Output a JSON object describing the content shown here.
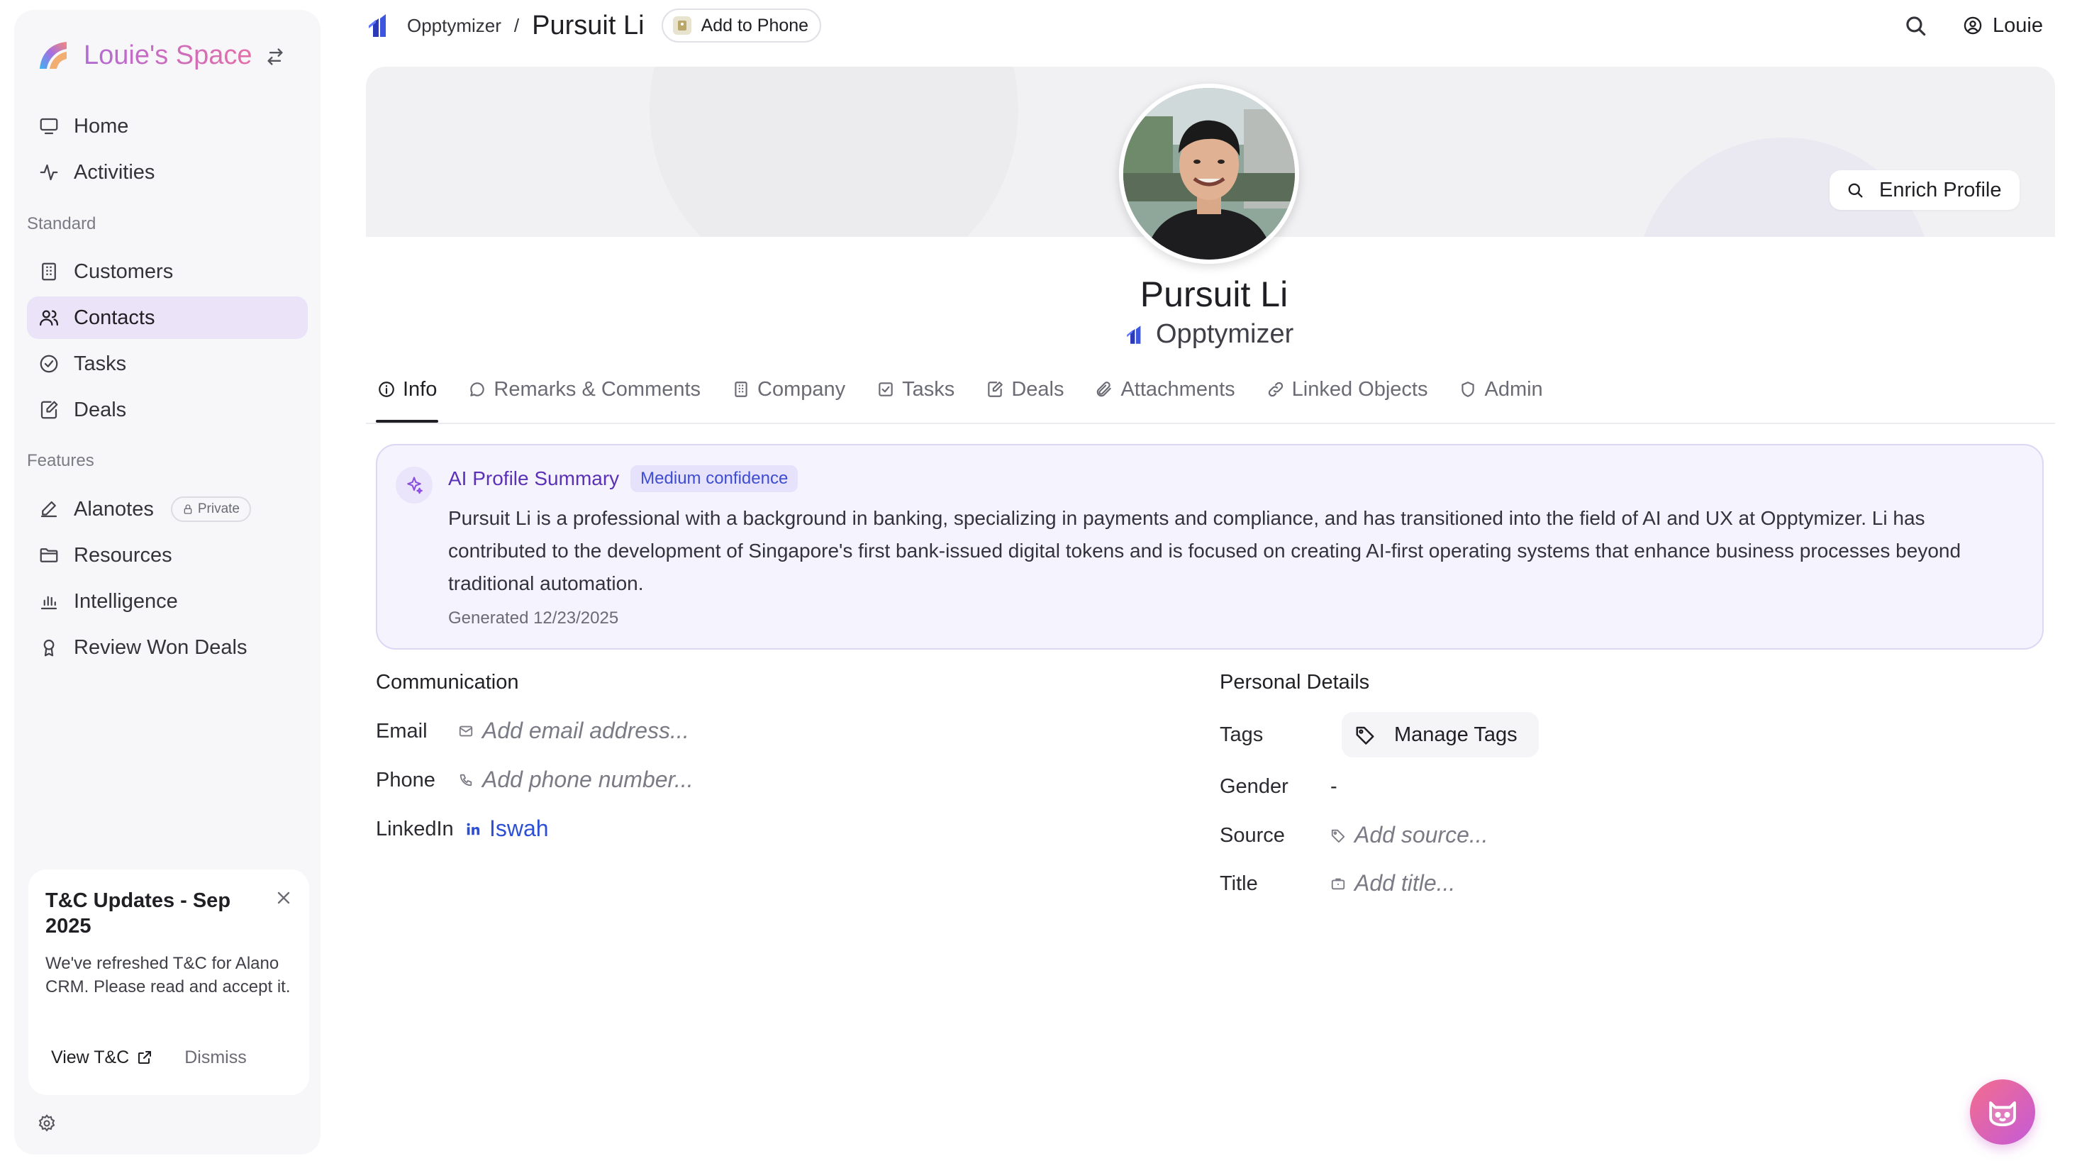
{
  "workspace": {
    "name": "Louie's Space"
  },
  "sidebar": {
    "items_main": [
      {
        "label": "Home",
        "icon": "monitor-icon"
      },
      {
        "label": "Activities",
        "icon": "activity-icon"
      }
    ],
    "standard_label": "Standard",
    "items_standard": [
      {
        "label": "Customers",
        "icon": "building-icon"
      },
      {
        "label": "Contacts",
        "icon": "users-icon",
        "active": true
      },
      {
        "label": "Tasks",
        "icon": "check-circle-icon"
      },
      {
        "label": "Deals",
        "icon": "edit-doc-icon"
      }
    ],
    "features_label": "Features",
    "items_features": [
      {
        "label": "Alanotes",
        "icon": "pen-icon",
        "badge": "Private"
      },
      {
        "label": "Resources",
        "icon": "folder-icon"
      },
      {
        "label": "Intelligence",
        "icon": "bar-chart-icon"
      },
      {
        "label": "Review Won Deals",
        "icon": "award-icon"
      }
    ]
  },
  "tc_notice": {
    "title": "T&C Updates - Sep 2025",
    "body": "We've refreshed T&C for Alano CRM. Please read and accept it.",
    "view_label": "View T&C",
    "dismiss_label": "Dismiss"
  },
  "breadcrumb": {
    "parent": "Opptymizer",
    "separator": "/",
    "current": "Pursuit Li"
  },
  "header": {
    "add_to_phone_label": "Add to Phone",
    "user_name": "Louie"
  },
  "profile": {
    "name": "Pursuit Li",
    "company": "Opptymizer",
    "enrich_label": "Enrich Profile"
  },
  "tabs": [
    {
      "label": "Info",
      "icon": "info-icon",
      "active": true
    },
    {
      "label": "Remarks & Comments",
      "icon": "comment-icon"
    },
    {
      "label": "Company",
      "icon": "building-icon"
    },
    {
      "label": "Tasks",
      "icon": "checkbox-icon"
    },
    {
      "label": "Deals",
      "icon": "edit-doc-icon"
    },
    {
      "label": "Attachments",
      "icon": "paperclip-icon"
    },
    {
      "label": "Linked Objects",
      "icon": "link-icon"
    },
    {
      "label": "Admin",
      "icon": "shield-icon"
    }
  ],
  "ai_summary": {
    "title": "AI Profile Summary",
    "confidence": "Medium confidence",
    "text": "Pursuit Li is a professional with a background in banking, specializing in payments and compliance, and has transitioned into the field of AI and UX at Opptymizer. Li has contributed to the development of Singapore's first bank-issued digital tokens and is focused on creating AI-first operating systems that enhance business processes beyond traditional automation.",
    "generated": "Generated 12/23/2025"
  },
  "communication": {
    "title": "Communication",
    "email_label": "Email",
    "email_placeholder": "Add email address...",
    "phone_label": "Phone",
    "phone_placeholder": "Add phone number...",
    "linkedin_label": "LinkedIn",
    "linkedin_value": "Iswah"
  },
  "personal": {
    "title": "Personal Details",
    "tags_label": "Tags",
    "manage_tags_label": "Manage Tags",
    "gender_label": "Gender",
    "gender_value": "-",
    "source_label": "Source",
    "source_placeholder": "Add source...",
    "title_label": "Title",
    "title_placeholder": "Add title..."
  },
  "colors": {
    "accent": "#ebe3f8",
    "ai_title": "#5b32b5",
    "link": "#2d4fd6",
    "fab_gradient": [
      "#f46d8d",
      "#c45ad8"
    ]
  }
}
